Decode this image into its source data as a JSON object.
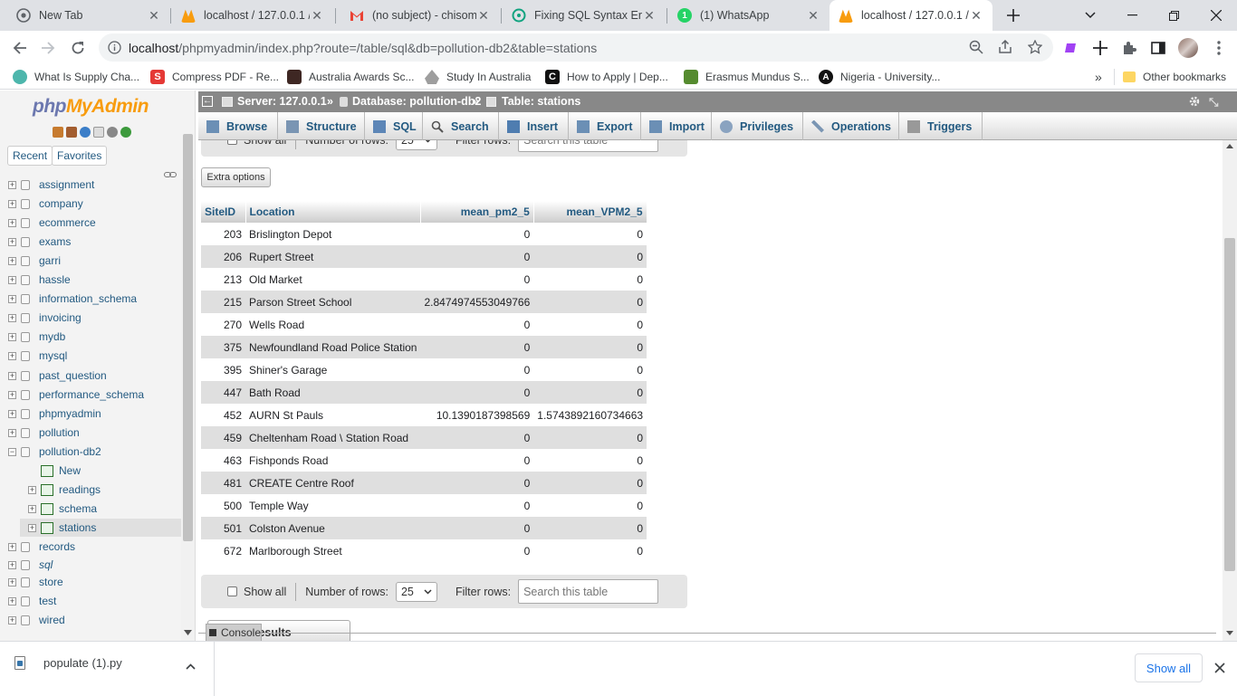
{
  "browser": {
    "tabs": [
      {
        "title": "New Tab",
        "active": false
      },
      {
        "title": "localhost / 127.0.0.1 /",
        "active": false
      },
      {
        "title": "(no subject) - chisom.",
        "active": false
      },
      {
        "title": "Fixing SQL Syntax Erro",
        "active": false
      },
      {
        "title": "(1) WhatsApp",
        "active": false
      },
      {
        "title": "localhost / 127.0.0.1 /",
        "active": true
      }
    ],
    "url_host": "localhost",
    "url_path": "/phpmyadmin/index.php?route=/table/sql&db=pollution-db2&table=stations",
    "bookmarks": [
      "What Is Supply Cha...",
      "Compress PDF - Re...",
      "Australia Awards Sc...",
      "Study In Australia",
      "How to Apply | Dep...",
      "Erasmus Mundus S...",
      "Nigeria - University..."
    ],
    "bookmarks_overflow": "»",
    "other_bookmarks": "Other bookmarks"
  },
  "pma": {
    "logo_php": "php",
    "logo_my": "MyAdmin",
    "nav_tabs": [
      "Recent",
      "Favorites"
    ],
    "databases": [
      {
        "name": "assignment",
        "indent": 0,
        "expander": "+"
      },
      {
        "name": "company",
        "indent": 0,
        "expander": "+"
      },
      {
        "name": "ecommerce",
        "indent": 0,
        "expander": "+"
      },
      {
        "name": "exams",
        "indent": 0,
        "expander": "+"
      },
      {
        "name": "garri",
        "indent": 0,
        "expander": "+"
      },
      {
        "name": "hassle",
        "indent": 0,
        "expander": "+"
      },
      {
        "name": "information_schema",
        "indent": 0,
        "expander": "+"
      },
      {
        "name": "invoicing",
        "indent": 0,
        "expander": "+"
      },
      {
        "name": "mydb",
        "indent": 0,
        "expander": "+"
      },
      {
        "name": "mysql",
        "indent": 0,
        "expander": "+"
      },
      {
        "name": "past_question",
        "indent": 0,
        "expander": "+"
      },
      {
        "name": "performance_schema",
        "indent": 0,
        "expander": "+"
      },
      {
        "name": "phpmyadmin",
        "indent": 0,
        "expander": "+"
      },
      {
        "name": "pollution",
        "indent": 0,
        "expander": "+"
      },
      {
        "name": "pollution-db2",
        "indent": 0,
        "expander": "−"
      },
      {
        "name": "New",
        "indent": 1,
        "expander": ""
      },
      {
        "name": "readings",
        "indent": 1,
        "expander": "+"
      },
      {
        "name": "schema",
        "indent": 1,
        "expander": "+"
      },
      {
        "name": "stations",
        "indent": 1,
        "expander": "+",
        "selected": true
      },
      {
        "name": "records",
        "indent": 0,
        "expander": "+"
      },
      {
        "name": "sql",
        "indent": 0,
        "expander": "+",
        "italic": true
      },
      {
        "name": "store",
        "indent": 0,
        "expander": "+"
      },
      {
        "name": "test",
        "indent": 0,
        "expander": "+"
      },
      {
        "name": "wired",
        "indent": 0,
        "expander": "+"
      }
    ],
    "breadcrumb": {
      "server": "Server: 127.0.0.1",
      "database": "Database: pollution-db2",
      "table": "Table: stations",
      "separator": "»"
    },
    "menu": [
      "Browse",
      "Structure",
      "SQL",
      "Search",
      "Insert",
      "Export",
      "Import",
      "Privileges",
      "Operations",
      "Triggers"
    ],
    "nav_controls": {
      "show_all": "Show all",
      "rows_label": "Number of rows:",
      "rows_value": "25",
      "filter_label": "Filter rows:",
      "filter_placeholder": "Search this table"
    },
    "extra_options": "Extra options",
    "table": {
      "columns": [
        "SiteID",
        "Location",
        "mean_pm2_5",
        "mean_VPM2_5"
      ],
      "rows": [
        [
          "203",
          "Brislington Depot",
          "0",
          "0"
        ],
        [
          "206",
          "Rupert Street",
          "0",
          "0"
        ],
        [
          "213",
          "Old Market",
          "0",
          "0"
        ],
        [
          "215",
          "Parson Street School",
          "2.8474974553049766",
          "0"
        ],
        [
          "270",
          "Wells Road",
          "0",
          "0"
        ],
        [
          "375",
          "Newfoundland Road Police Station",
          "0",
          "0"
        ],
        [
          "395",
          "Shiner's Garage",
          "0",
          "0"
        ],
        [
          "447",
          "Bath Road",
          "0",
          "0"
        ],
        [
          "452",
          "AURN St Pauls",
          "10.1390187398569",
          "1.5743892160734663"
        ],
        [
          "459",
          "Cheltenham Road \\ Station Road",
          "0",
          "0"
        ],
        [
          "463",
          "Fishponds Road",
          "0",
          "0"
        ],
        [
          "481",
          "CREATE Centre Roof",
          "0",
          "0"
        ],
        [
          "500",
          "Temple Way",
          "0",
          "0"
        ],
        [
          "501",
          "Colston Avenue",
          "0",
          "0"
        ],
        [
          "672",
          "Marlborough Street",
          "0",
          "0"
        ]
      ]
    },
    "query_results_ops": "Query results operations",
    "console": "Console"
  },
  "downloads": {
    "file": "populate (1).py",
    "show_all": "Show all"
  },
  "colors": {
    "link": "#235a81",
    "topbar": "#888888",
    "php": "#6c78af",
    "myadmin": "#f89c0e"
  }
}
